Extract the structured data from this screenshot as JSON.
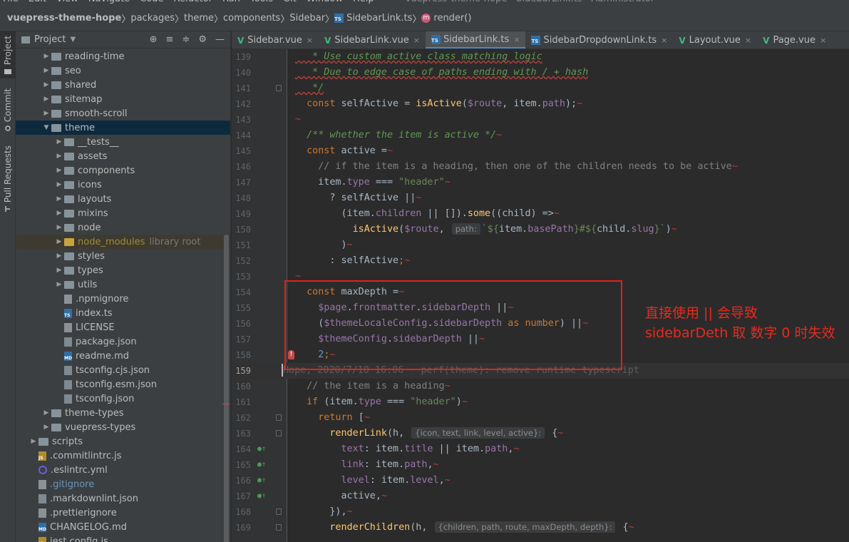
{
  "menu": {
    "items": [
      "File",
      "Edit",
      "View",
      "Navigate",
      "Code",
      "Refactor",
      "Run",
      "Tools",
      "Git",
      "Window",
      "Help"
    ],
    "title": "vuepress-theme-hope - SidebarLink.ts - Administrator"
  },
  "breadcrumb": [
    "vuepress-theme-hope",
    "packages",
    "theme",
    "components",
    "Sidebar",
    "SidebarLink.ts",
    "render()"
  ],
  "toolwindows": {
    "project": "Project",
    "commit": "Commit",
    "pull_requests": "Pull Requests"
  },
  "project_panel": {
    "title": "Project",
    "tree": [
      {
        "label": "reading-time",
        "kind": "folder",
        "depth": 2,
        "expand": "closed"
      },
      {
        "label": "seo",
        "kind": "folder",
        "depth": 2,
        "expand": "closed"
      },
      {
        "label": "shared",
        "kind": "folder",
        "depth": 2,
        "expand": "closed"
      },
      {
        "label": "sitemap",
        "kind": "folder",
        "depth": 2,
        "expand": "closed"
      },
      {
        "label": "smooth-scroll",
        "kind": "folder",
        "depth": 2,
        "expand": "closed"
      },
      {
        "label": "theme",
        "kind": "folder",
        "depth": 2,
        "expand": "open",
        "selected": true
      },
      {
        "label": "__tests__",
        "kind": "folder",
        "depth": 3,
        "expand": "closed"
      },
      {
        "label": "assets",
        "kind": "folder",
        "depth": 3,
        "expand": "closed"
      },
      {
        "label": "components",
        "kind": "folder",
        "depth": 3,
        "expand": "closed"
      },
      {
        "label": "icons",
        "kind": "folder",
        "depth": 3,
        "expand": "closed"
      },
      {
        "label": "layouts",
        "kind": "folder",
        "depth": 3,
        "expand": "closed"
      },
      {
        "label": "mixins",
        "kind": "folder",
        "depth": 3,
        "expand": "closed"
      },
      {
        "label": "node",
        "kind": "folder",
        "depth": 3,
        "expand": "closed"
      },
      {
        "label": "node_modules",
        "kind": "folder-excluded",
        "depth": 3,
        "expand": "closed",
        "extra": "library root"
      },
      {
        "label": "styles",
        "kind": "folder",
        "depth": 3,
        "expand": "closed"
      },
      {
        "label": "types",
        "kind": "folder",
        "depth": 3,
        "expand": "closed"
      },
      {
        "label": "utils",
        "kind": "folder",
        "depth": 3,
        "expand": "closed"
      },
      {
        "label": ".npmignore",
        "kind": "file",
        "depth": 3
      },
      {
        "label": "index.ts",
        "kind": "ts",
        "depth": 3
      },
      {
        "label": "LICENSE",
        "kind": "file",
        "depth": 3
      },
      {
        "label": "package.json",
        "kind": "json",
        "depth": 3
      },
      {
        "label": "readme.md",
        "kind": "md",
        "depth": 3
      },
      {
        "label": "tsconfig.cjs.json",
        "kind": "json",
        "depth": 3
      },
      {
        "label": "tsconfig.esm.json",
        "kind": "json",
        "depth": 3
      },
      {
        "label": "tsconfig.json",
        "kind": "json",
        "depth": 3
      },
      {
        "label": "theme-types",
        "kind": "folder",
        "depth": 2,
        "expand": "closed"
      },
      {
        "label": "vuepress-types",
        "kind": "folder",
        "depth": 2,
        "expand": "closed"
      },
      {
        "label": "scripts",
        "kind": "folder",
        "depth": 1,
        "expand": "closed"
      },
      {
        "label": ".commitlintrc.js",
        "kind": "js",
        "depth": 1
      },
      {
        "label": ".eslintrc.yml",
        "kind": "eslint",
        "depth": 1
      },
      {
        "label": ".gitignore",
        "kind": "file",
        "depth": 1,
        "git": true
      },
      {
        "label": ".markdownlint.json",
        "kind": "json",
        "depth": 1
      },
      {
        "label": ".prettierignore",
        "kind": "file",
        "depth": 1
      },
      {
        "label": "CHANGELOG.md",
        "kind": "md",
        "depth": 1
      },
      {
        "label": "jest.config.js",
        "kind": "js",
        "depth": 1
      }
    ]
  },
  "tabs": [
    {
      "label": "Sidebar.vue",
      "icon": "vue"
    },
    {
      "label": "SidebarLink.vue",
      "icon": "vue"
    },
    {
      "label": "SidebarLink.ts",
      "icon": "ts",
      "active": true
    },
    {
      "label": "SidebarDropdownLink.ts",
      "icon": "ts"
    },
    {
      "label": "Layout.vue",
      "icon": "vue"
    },
    {
      "label": "Page.vue",
      "icon": "vue"
    }
  ],
  "editor": {
    "current_line": 159,
    "blame_text": "Hope, 2020/7/10 16:06 · perf(theme): remove runtime typescript",
    "hints": {
      "path": "path:",
      "renderLink": "{icon, text, link, level, active}:",
      "renderChildren": "{children, path, route, maxDepth, depth}:"
    }
  },
  "annotation": {
    "text": "直接使用 || 会导致 sidebarDeth 取 数字 0 时失效",
    "color": "#e62b20"
  },
  "colors": {
    "accent": "#4a88c7",
    "annotation_box": "#e0221c"
  }
}
